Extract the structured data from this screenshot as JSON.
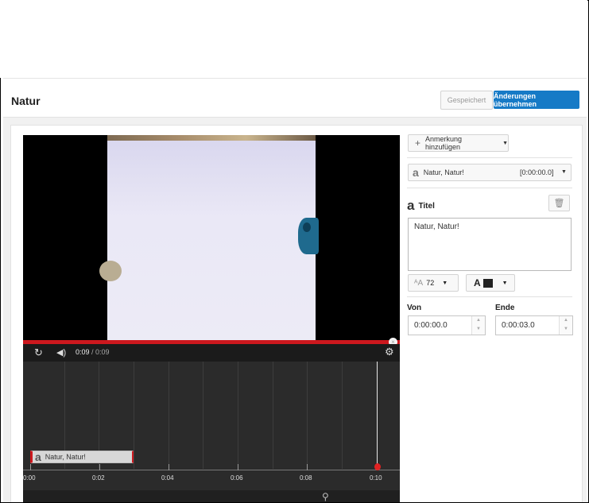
{
  "header": {
    "title": "Natur",
    "saved_label": "Gespeichert",
    "apply_label": "Änderungen übernehmen"
  },
  "player": {
    "current_time": "0:09",
    "duration": "/ 0:09",
    "progress_percent": 100
  },
  "timeline": {
    "ticks": [
      "0:00",
      "0:02",
      "0:04",
      "0:06",
      "0:08",
      "0:10"
    ],
    "clip_label": "Natur, Natur!"
  },
  "editor": {
    "add_annotation_label": "Anmerkung hinzufügen",
    "selected_annotation": {
      "name": "Natur, Natur!",
      "time": "[0:00:00.0]"
    },
    "type_label": "Titel",
    "text_value": "Natur, Natur!",
    "font_size": "72",
    "font_color": "#222222",
    "start_label": "Von",
    "end_label": "Ende",
    "start_value": "0:00:00.0",
    "end_value": "0:00:03.0"
  },
  "colors": {
    "accent": "#167ac6",
    "progress": "#cc181e"
  }
}
